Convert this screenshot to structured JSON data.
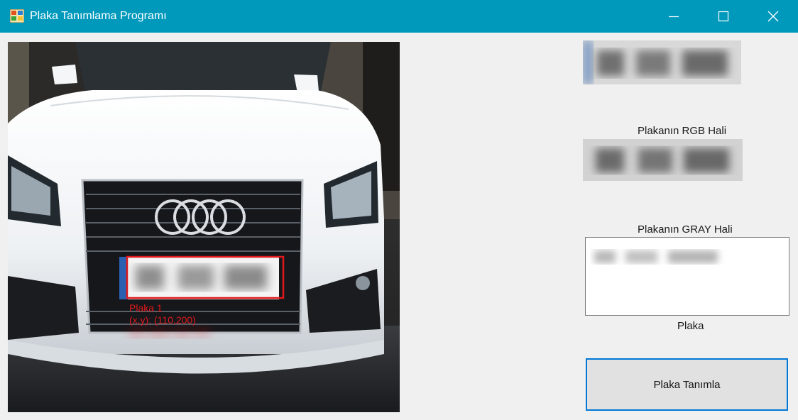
{
  "window": {
    "title": "Plaka Tanımlama Programı",
    "controls": [
      "minimize-icon",
      "maximize-icon",
      "close-icon"
    ]
  },
  "detection": {
    "label": "Plaka 1",
    "coords": "(x,y): (110,200)",
    "size": "w,h: (xxx, 1x2, 37)"
  },
  "labels": {
    "rgb": "Plakanın RGB Hali",
    "gray": "Plakanın GRAY Hali",
    "plate": "Plaka"
  },
  "button": {
    "label": "Plaka Tanımla"
  },
  "colors": {
    "titlebar": "#0099bc",
    "detection_box": "#e0181c",
    "button_border": "#0078d7"
  }
}
